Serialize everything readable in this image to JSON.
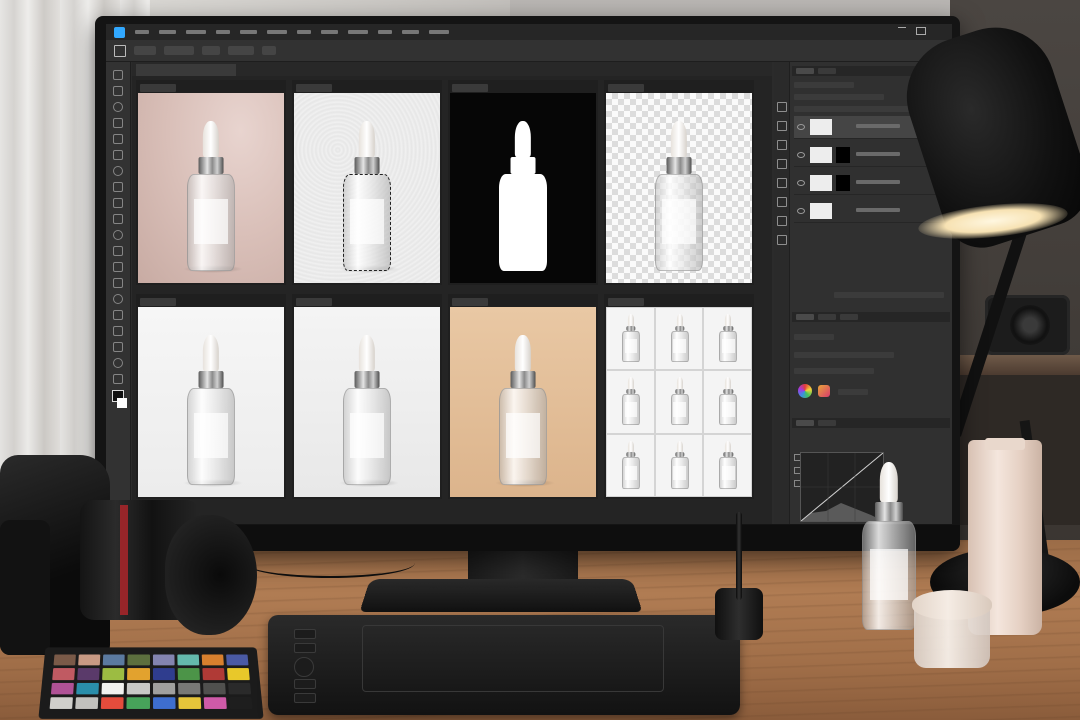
{
  "scene": {
    "colors": {
      "desk": "#a87450",
      "screen_bg": "#2b2b2b",
      "app_accent": "#31a8ff",
      "lamp_glow": "#f7e2b3"
    }
  },
  "monitor": {
    "app": {
      "icon": "photoshop-icon",
      "menu_icons": [
        "menu-file",
        "menu-edit",
        "menu-image",
        "menu-layer",
        "menu-type",
        "menu-select",
        "menu-filter",
        "menu-3d",
        "menu-view",
        "menu-plugins",
        "menu-window",
        "menu-help"
      ],
      "toolbar_icons": [
        "move-icon",
        "marquee-icon",
        "lasso-icon",
        "crop-icon",
        "frame-icon",
        "eyedropper-icon",
        "healing-icon",
        "brush-icon",
        "stamp-icon",
        "history-brush-icon",
        "eraser-icon",
        "gradient-icon",
        "blur-icon",
        "dodge-icon",
        "pen-icon",
        "type-icon",
        "path-select-icon",
        "shape-icon",
        "hand-icon",
        "zoom-icon"
      ]
    },
    "canvas": {
      "cells": [
        {
          "id": "cell-1",
          "background": "pink-drape",
          "variant": "normal"
        },
        {
          "id": "cell-2",
          "background": "textured-white",
          "variant": "selection"
        },
        {
          "id": "cell-3",
          "background": "black",
          "variant": "silhouette-mask"
        },
        {
          "id": "cell-4",
          "background": "transparent-checker",
          "variant": "cutout"
        },
        {
          "id": "cell-5",
          "background": "white",
          "variant": "normal"
        },
        {
          "id": "cell-6",
          "background": "white-shadow",
          "variant": "normal"
        },
        {
          "id": "cell-7",
          "background": "beige",
          "variant": "normal"
        },
        {
          "id": "cell-8",
          "background": "grid-white",
          "variant": "contact-sheet",
          "grid": [
            3,
            3
          ]
        }
      ]
    },
    "panels": {
      "layers": {
        "rows": 4,
        "selected_row": 0
      },
      "adjustment_icons": [
        "color-wheel-icon",
        "palette-icon"
      ],
      "curves": {
        "visible": true
      }
    }
  },
  "desk_items": {
    "color_checker": {
      "swatches": [
        "#7a5a48",
        "#c89a84",
        "#5b7aa0",
        "#5c6f3e",
        "#8384b0",
        "#64b9ac",
        "#d8802e",
        "#4a5aa4",
        "#c05a62",
        "#5a3a6a",
        "#9cbc42",
        "#e2a22e",
        "#2f3d8e",
        "#4c9448",
        "#b03a36",
        "#e8c82a",
        "#b05296",
        "#2a8eaa",
        "#f2f2f0",
        "#c8c8c6",
        "#a0a09e",
        "#787876",
        "#50504e",
        "#2a2a2a",
        "#d0cfcb",
        "#c2c1bd",
        "#e44c3c",
        "#47a35a",
        "#3e6ecf",
        "#e6c43a",
        "#cf5aa8",
        "#1e1e1e"
      ]
    }
  }
}
